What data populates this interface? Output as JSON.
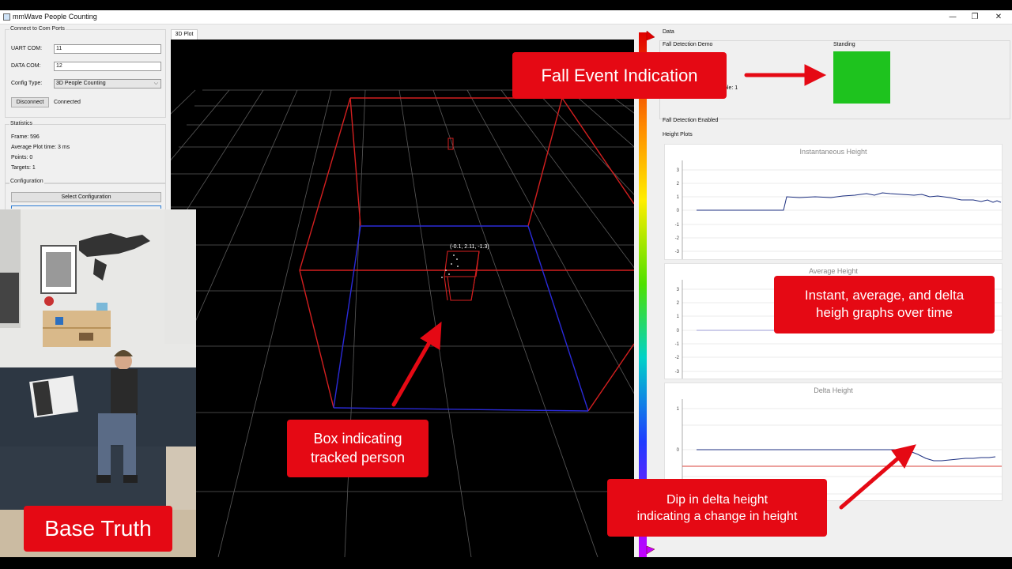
{
  "window": {
    "title": "mmWave People Counting",
    "controls": [
      "—",
      "❐",
      "✕"
    ]
  },
  "connect": {
    "group_title": "Connect to Com Ports",
    "uart_label": "UART COM:",
    "uart_value": "11",
    "data_label": "DATA COM:",
    "data_value": "12",
    "config_label": "Config Type:",
    "config_value": "3D People Counting",
    "disconnect_label": "Disconnect",
    "status": "Connected"
  },
  "statistics": {
    "group_title": "Statistics",
    "frame": "Frame: 596",
    "plot_time": "Average Plot time: 3 ms",
    "points": "Points: 0",
    "targets": "Targets: 1"
  },
  "configuration": {
    "group_title": "Configuration",
    "select_label": "Select Configuration"
  },
  "plot": {
    "tab_label": "3D Plot",
    "target_label": "(-0.1, 2.11, -1.3)"
  },
  "data_panel": {
    "group_title": "Data",
    "fall_demo_label": "Fall Detection Demo",
    "partial_text": "ble: 1",
    "status_label": "Standing",
    "status_color": "#1ec31e",
    "fall_enabled_label": "Fall Detection Enabled",
    "height_plots_label": "Height Plots"
  },
  "charts": {
    "instant": {
      "title": "Instantaneous Height",
      "ticks": [
        "3",
        "2",
        "1",
        "0",
        "-1",
        "-2",
        "-3"
      ]
    },
    "average": {
      "title": "Average Height",
      "ticks": [
        "3",
        "2",
        "1",
        "0",
        "-1",
        "-2",
        "-3"
      ]
    },
    "delta": {
      "title": "Delta Height",
      "ticks": [
        "1",
        "0"
      ]
    }
  },
  "annotations": {
    "fall_event": "Fall Event Indication",
    "graphs_line1": "Instant, average, and delta",
    "graphs_line2": "heigh graphs over time",
    "box_line1": "Box indicating",
    "box_line2": "tracked person",
    "dip_line1": "Dip in delta height",
    "dip_line2": "indicating a change in height",
    "base_truth": "Base Truth"
  },
  "colors": {
    "accent_red": "#e50914",
    "plot_line": "#1c2f80",
    "threshold_line": "#d9403a"
  }
}
